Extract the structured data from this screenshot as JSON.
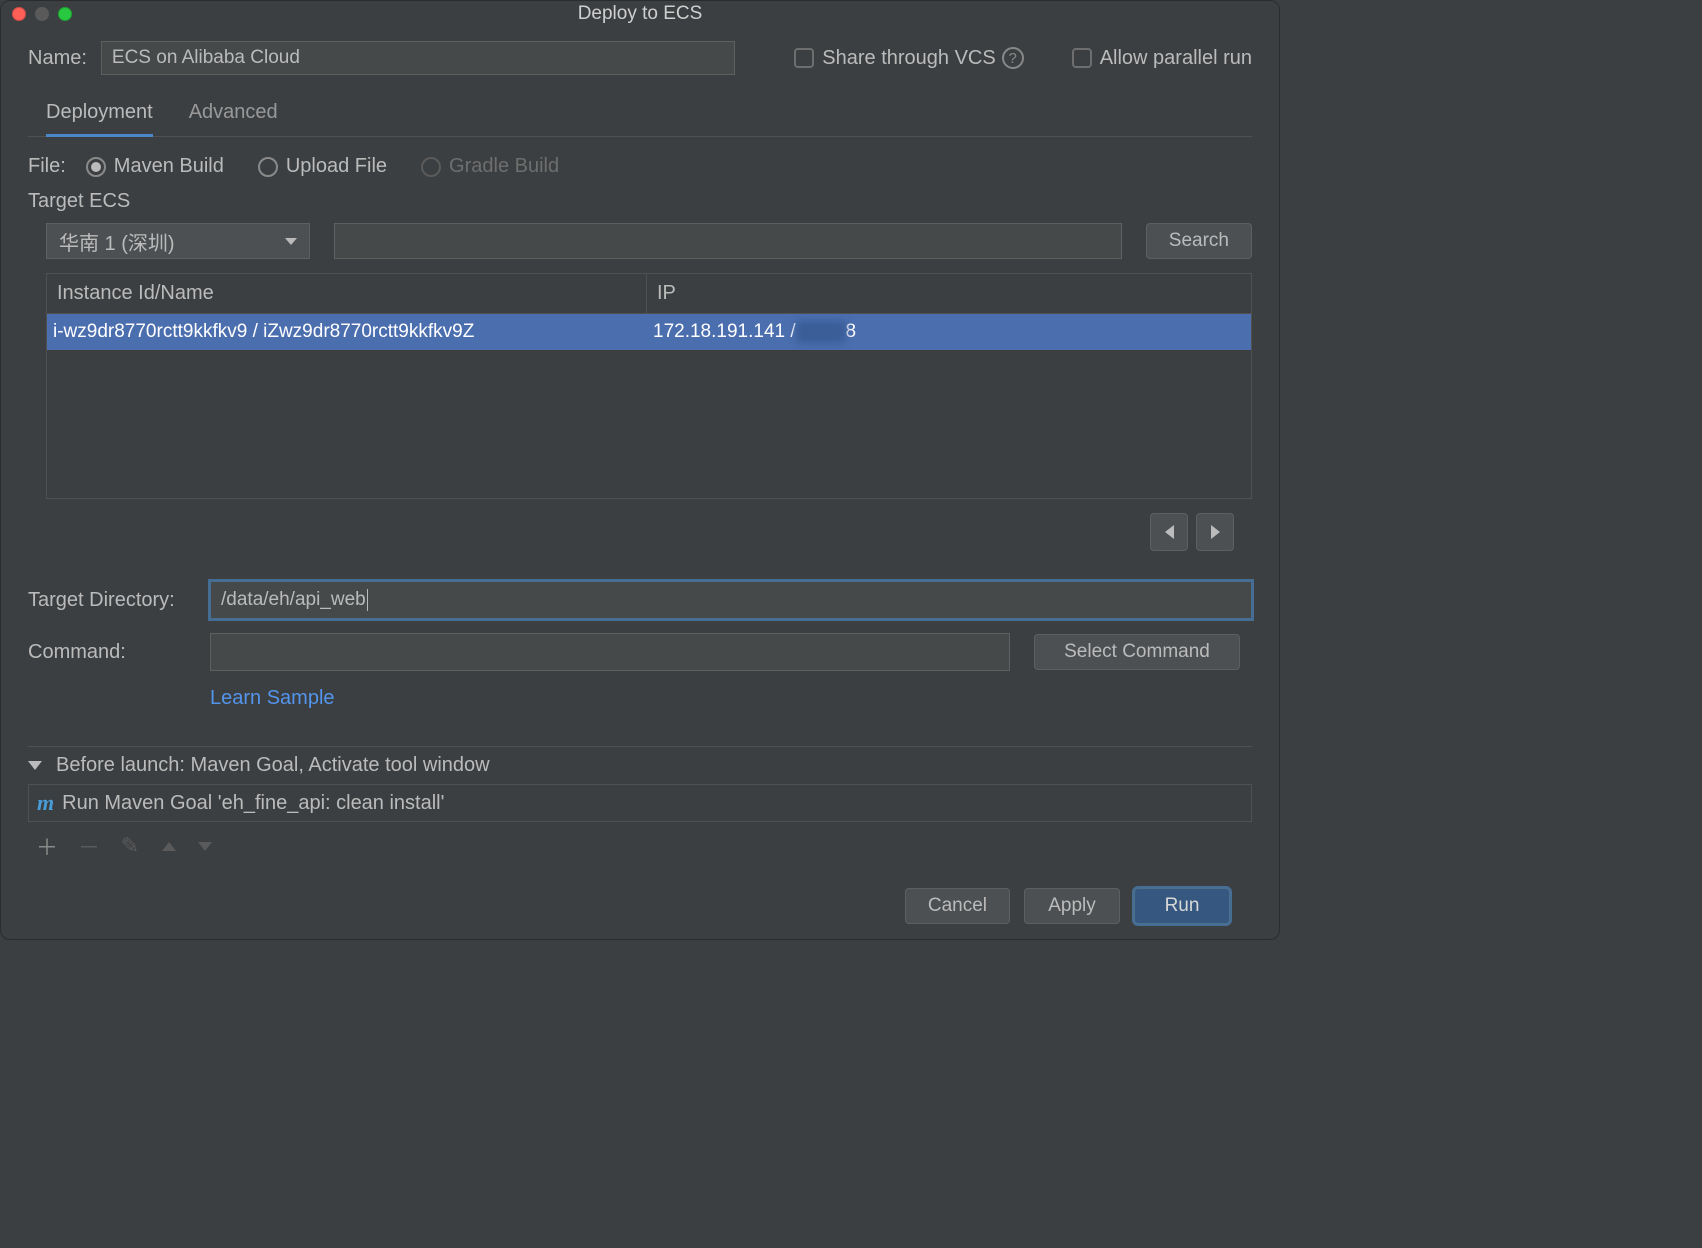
{
  "window": {
    "title": "Deploy to ECS"
  },
  "nameRow": {
    "label": "Name:",
    "value": "ECS on Alibaba Cloud"
  },
  "shareVcs": {
    "label": "Share through VCS"
  },
  "allowParallel": {
    "label": "Allow parallel run"
  },
  "tabs": {
    "deployment": "Deployment",
    "advanced": "Advanced"
  },
  "fileRow": {
    "label": "File:",
    "maven": "Maven Build",
    "upload": "Upload File",
    "gradle": "Gradle Build"
  },
  "targetEcs": {
    "label": "Target ECS"
  },
  "region": {
    "selected": "华南 1 (深圳)"
  },
  "searchBtn": "Search",
  "table": {
    "col1": "Instance Id/Name",
    "col2": "IP",
    "row": {
      "id": "i-wz9dr8770rctt9kkfkv9 / iZwz9dr8770rctt9kkfkv9Z",
      "ipPrefix": "172.18.191.141 / ",
      "ipHidden": "■■■■",
      "ipSuffix": "8"
    }
  },
  "targetDir": {
    "label": "Target Directory:",
    "value": "/data/eh/api_web"
  },
  "command": {
    "label": "Command:",
    "value": "",
    "selectBtn": "Select Command"
  },
  "learn": "Learn Sample",
  "beforeLaunch": {
    "header": "Before launch: Maven Goal, Activate tool window",
    "item": "Run Maven Goal 'eh_fine_api: clean install'"
  },
  "footer": {
    "cancel": "Cancel",
    "apply": "Apply",
    "run": "Run"
  }
}
